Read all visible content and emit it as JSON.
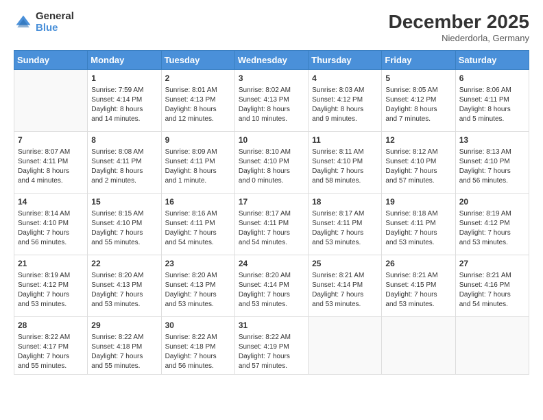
{
  "logo": {
    "general": "General",
    "blue": "Blue"
  },
  "title": "December 2025",
  "subtitle": "Niederdorla, Germany",
  "days_of_week": [
    "Sunday",
    "Monday",
    "Tuesday",
    "Wednesday",
    "Thursday",
    "Friday",
    "Saturday"
  ],
  "weeks": [
    [
      {
        "num": "",
        "info": ""
      },
      {
        "num": "1",
        "info": "Sunrise: 7:59 AM\nSunset: 4:14 PM\nDaylight: 8 hours\nand 14 minutes."
      },
      {
        "num": "2",
        "info": "Sunrise: 8:01 AM\nSunset: 4:13 PM\nDaylight: 8 hours\nand 12 minutes."
      },
      {
        "num": "3",
        "info": "Sunrise: 8:02 AM\nSunset: 4:13 PM\nDaylight: 8 hours\nand 10 minutes."
      },
      {
        "num": "4",
        "info": "Sunrise: 8:03 AM\nSunset: 4:12 PM\nDaylight: 8 hours\nand 9 minutes."
      },
      {
        "num": "5",
        "info": "Sunrise: 8:05 AM\nSunset: 4:12 PM\nDaylight: 8 hours\nand 7 minutes."
      },
      {
        "num": "6",
        "info": "Sunrise: 8:06 AM\nSunset: 4:11 PM\nDaylight: 8 hours\nand 5 minutes."
      }
    ],
    [
      {
        "num": "7",
        "info": "Sunrise: 8:07 AM\nSunset: 4:11 PM\nDaylight: 8 hours\nand 4 minutes."
      },
      {
        "num": "8",
        "info": "Sunrise: 8:08 AM\nSunset: 4:11 PM\nDaylight: 8 hours\nand 2 minutes."
      },
      {
        "num": "9",
        "info": "Sunrise: 8:09 AM\nSunset: 4:11 PM\nDaylight: 8 hours\nand 1 minute."
      },
      {
        "num": "10",
        "info": "Sunrise: 8:10 AM\nSunset: 4:10 PM\nDaylight: 8 hours\nand 0 minutes."
      },
      {
        "num": "11",
        "info": "Sunrise: 8:11 AM\nSunset: 4:10 PM\nDaylight: 7 hours\nand 58 minutes."
      },
      {
        "num": "12",
        "info": "Sunrise: 8:12 AM\nSunset: 4:10 PM\nDaylight: 7 hours\nand 57 minutes."
      },
      {
        "num": "13",
        "info": "Sunrise: 8:13 AM\nSunset: 4:10 PM\nDaylight: 7 hours\nand 56 minutes."
      }
    ],
    [
      {
        "num": "14",
        "info": "Sunrise: 8:14 AM\nSunset: 4:10 PM\nDaylight: 7 hours\nand 56 minutes."
      },
      {
        "num": "15",
        "info": "Sunrise: 8:15 AM\nSunset: 4:10 PM\nDaylight: 7 hours\nand 55 minutes."
      },
      {
        "num": "16",
        "info": "Sunrise: 8:16 AM\nSunset: 4:11 PM\nDaylight: 7 hours\nand 54 minutes."
      },
      {
        "num": "17",
        "info": "Sunrise: 8:17 AM\nSunset: 4:11 PM\nDaylight: 7 hours\nand 54 minutes."
      },
      {
        "num": "18",
        "info": "Sunrise: 8:17 AM\nSunset: 4:11 PM\nDaylight: 7 hours\nand 53 minutes."
      },
      {
        "num": "19",
        "info": "Sunrise: 8:18 AM\nSunset: 4:11 PM\nDaylight: 7 hours\nand 53 minutes."
      },
      {
        "num": "20",
        "info": "Sunrise: 8:19 AM\nSunset: 4:12 PM\nDaylight: 7 hours\nand 53 minutes."
      }
    ],
    [
      {
        "num": "21",
        "info": "Sunrise: 8:19 AM\nSunset: 4:12 PM\nDaylight: 7 hours\nand 53 minutes."
      },
      {
        "num": "22",
        "info": "Sunrise: 8:20 AM\nSunset: 4:13 PM\nDaylight: 7 hours\nand 53 minutes."
      },
      {
        "num": "23",
        "info": "Sunrise: 8:20 AM\nSunset: 4:13 PM\nDaylight: 7 hours\nand 53 minutes."
      },
      {
        "num": "24",
        "info": "Sunrise: 8:20 AM\nSunset: 4:14 PM\nDaylight: 7 hours\nand 53 minutes."
      },
      {
        "num": "25",
        "info": "Sunrise: 8:21 AM\nSunset: 4:14 PM\nDaylight: 7 hours\nand 53 minutes."
      },
      {
        "num": "26",
        "info": "Sunrise: 8:21 AM\nSunset: 4:15 PM\nDaylight: 7 hours\nand 53 minutes."
      },
      {
        "num": "27",
        "info": "Sunrise: 8:21 AM\nSunset: 4:16 PM\nDaylight: 7 hours\nand 54 minutes."
      }
    ],
    [
      {
        "num": "28",
        "info": "Sunrise: 8:22 AM\nSunset: 4:17 PM\nDaylight: 7 hours\nand 55 minutes."
      },
      {
        "num": "29",
        "info": "Sunrise: 8:22 AM\nSunset: 4:18 PM\nDaylight: 7 hours\nand 55 minutes."
      },
      {
        "num": "30",
        "info": "Sunrise: 8:22 AM\nSunset: 4:18 PM\nDaylight: 7 hours\nand 56 minutes."
      },
      {
        "num": "31",
        "info": "Sunrise: 8:22 AM\nSunset: 4:19 PM\nDaylight: 7 hours\nand 57 minutes."
      },
      {
        "num": "",
        "info": ""
      },
      {
        "num": "",
        "info": ""
      },
      {
        "num": "",
        "info": ""
      }
    ]
  ]
}
